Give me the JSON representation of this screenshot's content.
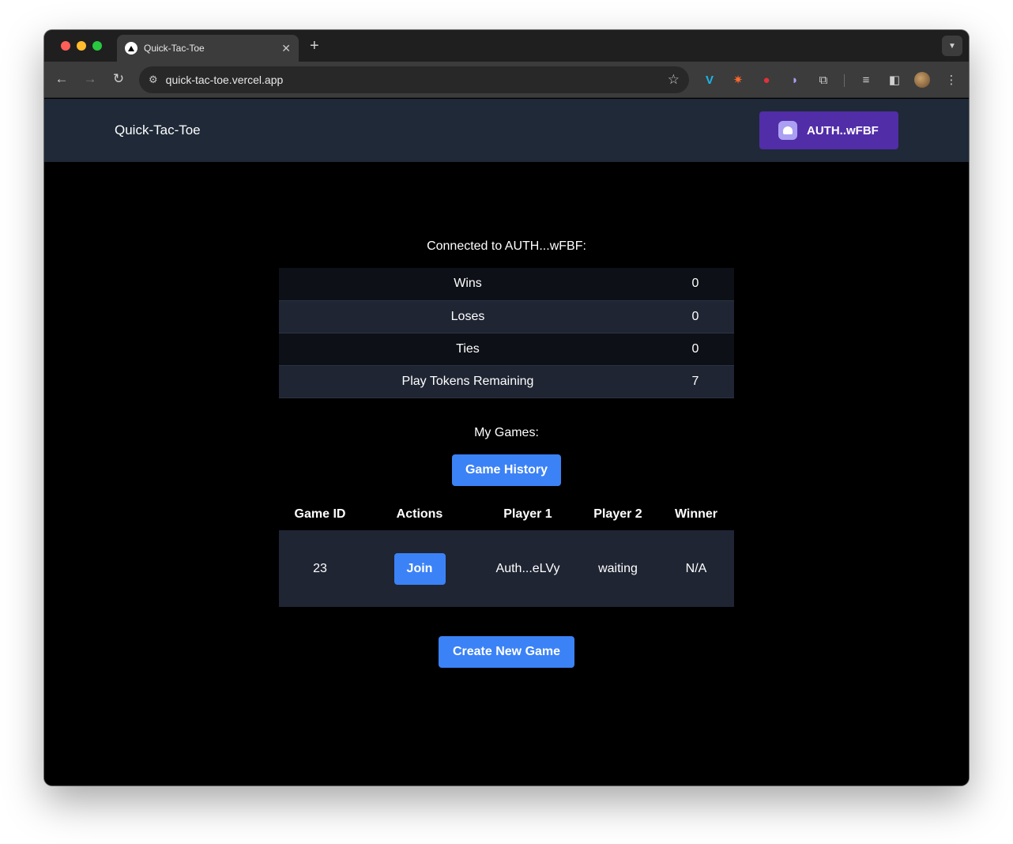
{
  "browser": {
    "tab_title": "Quick-Tac-Toe",
    "new_tab": "+",
    "url": "quick-tac-toe.vercel.app"
  },
  "app": {
    "title": "Quick-Tac-Toe",
    "wallet_label": "AUTH..wFBF"
  },
  "connected_text": "Connected to AUTH...wFBF:",
  "stats": [
    {
      "label": "Wins",
      "value": "0"
    },
    {
      "label": "Loses",
      "value": "0"
    },
    {
      "label": "Ties",
      "value": "0"
    },
    {
      "label": "Play Tokens Remaining",
      "value": "7"
    }
  ],
  "my_games_label": "My Games:",
  "game_history_button": "Game History",
  "games_table": {
    "headers": [
      "Game ID",
      "Actions",
      "Player 1",
      "Player 2",
      "Winner"
    ],
    "rows": [
      {
        "game_id": "23",
        "action": "Join",
        "player1": "Auth...eLVy",
        "player2": "waiting",
        "winner": "N/A"
      }
    ]
  },
  "create_button": "Create New Game",
  "colors": {
    "header_bg": "#1f2937",
    "wallet_btn": "#512da8",
    "primary_btn": "#3b82f6"
  }
}
